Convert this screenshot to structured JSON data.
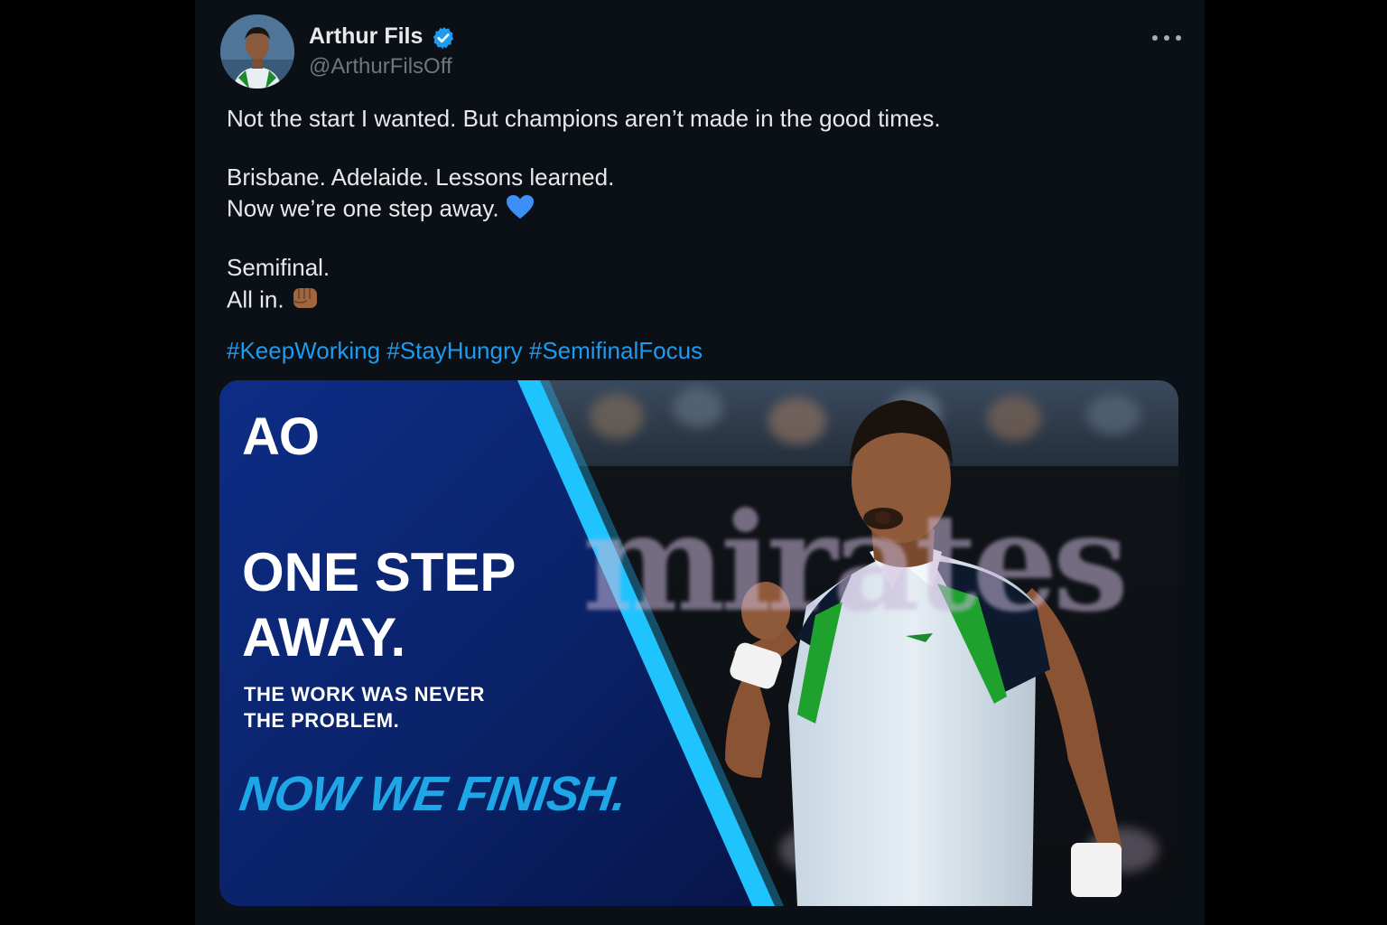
{
  "author": {
    "display_name": "Arthur Fils",
    "handle": "@ArthurFilsOff",
    "verified": true
  },
  "icons": {
    "verified": "verified-badge-icon",
    "more": "more-options-icon",
    "heart": "blue-heart-emoji",
    "fist": "fist-bump-emoji"
  },
  "tweet": {
    "lines": [
      "Not the start I wanted. But champions aren’t made in the good times.",
      "Brisbane. Adelaide. Lessons learned.",
      "Now we’re one step away.",
      "Semifinal.",
      "All in."
    ],
    "hashtags": [
      "#KeepWorking",
      "#StayHungry",
      "#SemifinalFocus"
    ]
  },
  "media": {
    "logo": "AO",
    "headline_1": "ONE STEP",
    "headline_2": "AWAY.",
    "subline_1": "THE WORK WAS NEVER",
    "subline_2": "THE PROBLEM.",
    "tagline": "NOW WE FINISH.",
    "background_text": "mirates"
  },
  "colors": {
    "background": "#0b1017",
    "text": "#e7e9ea",
    "secondary_text": "#71767b",
    "link": "#1d9bf0",
    "ao_blue": "#0a2a7a",
    "ao_cyan": "#1fc4ff"
  }
}
